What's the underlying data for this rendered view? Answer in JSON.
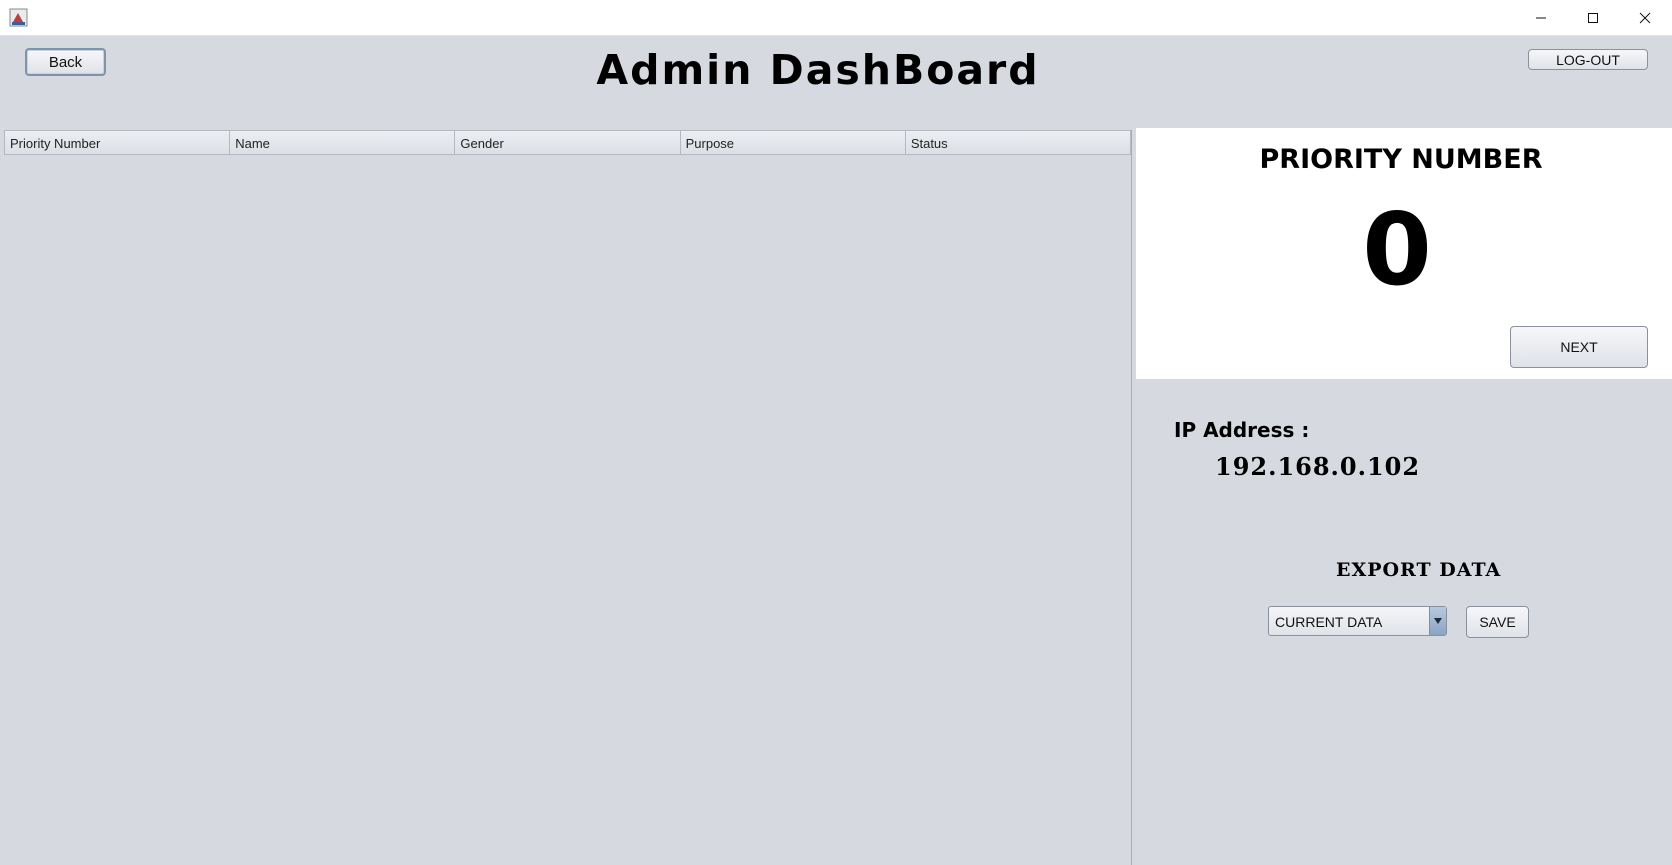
{
  "window": {
    "icon": "java-app-icon",
    "controls": [
      "minimize-icon",
      "maximize-icon",
      "close-icon"
    ]
  },
  "header": {
    "back_label": "Back",
    "title": "Admin DashBoard",
    "logout_label": "LOG-OUT"
  },
  "table": {
    "columns": [
      "Priority Number",
      "Name",
      "Gender",
      "Purpose",
      "Status"
    ],
    "rows": []
  },
  "priority": {
    "title": "PRIORITY NUMBER",
    "value": "0",
    "next_label": "NEXT"
  },
  "network": {
    "ip_label": "IP Address :",
    "ip_value": "192.168.0.102"
  },
  "export": {
    "title": "EXPORT DATA",
    "selected_option": "CURRENT DATA",
    "save_label": "SAVE"
  }
}
